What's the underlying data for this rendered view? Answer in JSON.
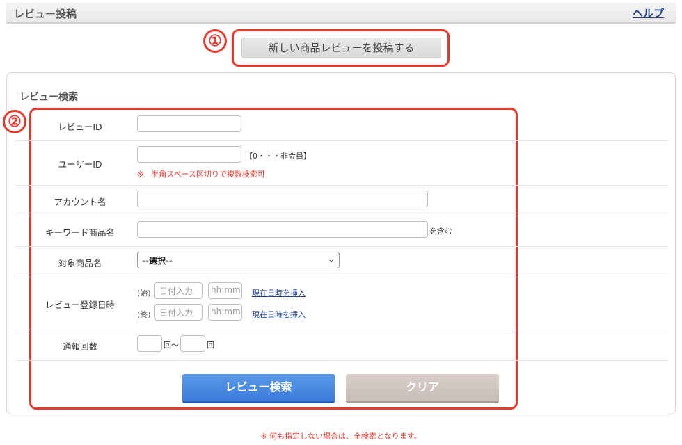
{
  "header": {
    "title": "レビュー投稿",
    "help": "ヘルプ"
  },
  "callouts": {
    "one": "①",
    "two": "②"
  },
  "new_review_button": "新しい商品レビューを投稿する",
  "search": {
    "title": "レビュー検索",
    "review_id_label": "レビューID",
    "user_id_label": "ユーザーID",
    "user_id_hint": "【0・・・非会員】",
    "user_id_note": "※　半角スペース区切りで複数検索可",
    "account_label": "アカウント名",
    "keyword_label": "キーワード商品名",
    "keyword_suffix": "を含む",
    "target_label": "対象商品名",
    "target_selected": "--選択--",
    "date_label": "レビュー登録日時",
    "start_prefix": "(始)",
    "end_prefix": "(終)",
    "date_placeholder": "日付入力",
    "time_placeholder": "hh:mm",
    "insert_now": "現在日時を挿入",
    "report_label": "通報回数",
    "count_unit_from": "回～",
    "count_unit_to": "回",
    "search_button": "レビュー検索",
    "clear_button": "クリア"
  },
  "footer_note": "※ 何も指定しない場合は、全検索となります。",
  "colors": {
    "accent_red": "#e53a2e",
    "primary_blue": "#3b7bd9",
    "link_blue": "#1f3f8f"
  }
}
